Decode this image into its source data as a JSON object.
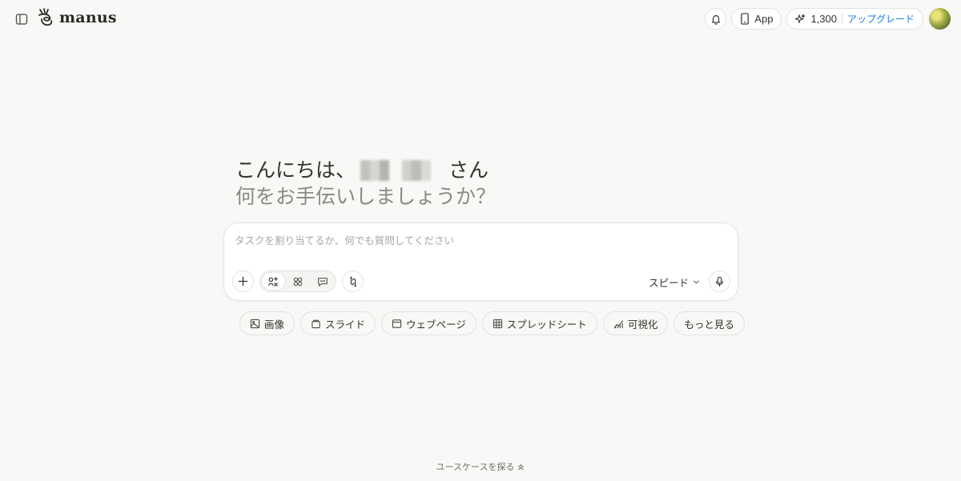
{
  "app": {
    "brand": "manus"
  },
  "header": {
    "app_button_label": "App",
    "credits": "1,300",
    "upgrade_label": "アップグレード"
  },
  "greeting": {
    "line1_prefix": "こんにちは、",
    "line1_suffix": "さん",
    "line2": "何をお手伝いしましょうか？"
  },
  "composer": {
    "placeholder": "タスクを割り当てるか、何でも質問してください",
    "value": "",
    "speed_label": "スピード"
  },
  "chips": [
    {
      "label": "画像",
      "icon": "image-icon"
    },
    {
      "label": "スライド",
      "icon": "slides-icon"
    },
    {
      "label": "ウェブページ",
      "icon": "browser-icon"
    },
    {
      "label": "スプレッドシート",
      "icon": "table-icon"
    },
    {
      "label": "可視化",
      "icon": "chart-icon"
    },
    {
      "label": "もっと見る",
      "icon": ""
    }
  ],
  "footer": {
    "explore_label": "ユースケースを探る"
  },
  "colors": {
    "background": "#f8f8f7",
    "accent": "#1a7fe0",
    "text": "#34322d"
  }
}
